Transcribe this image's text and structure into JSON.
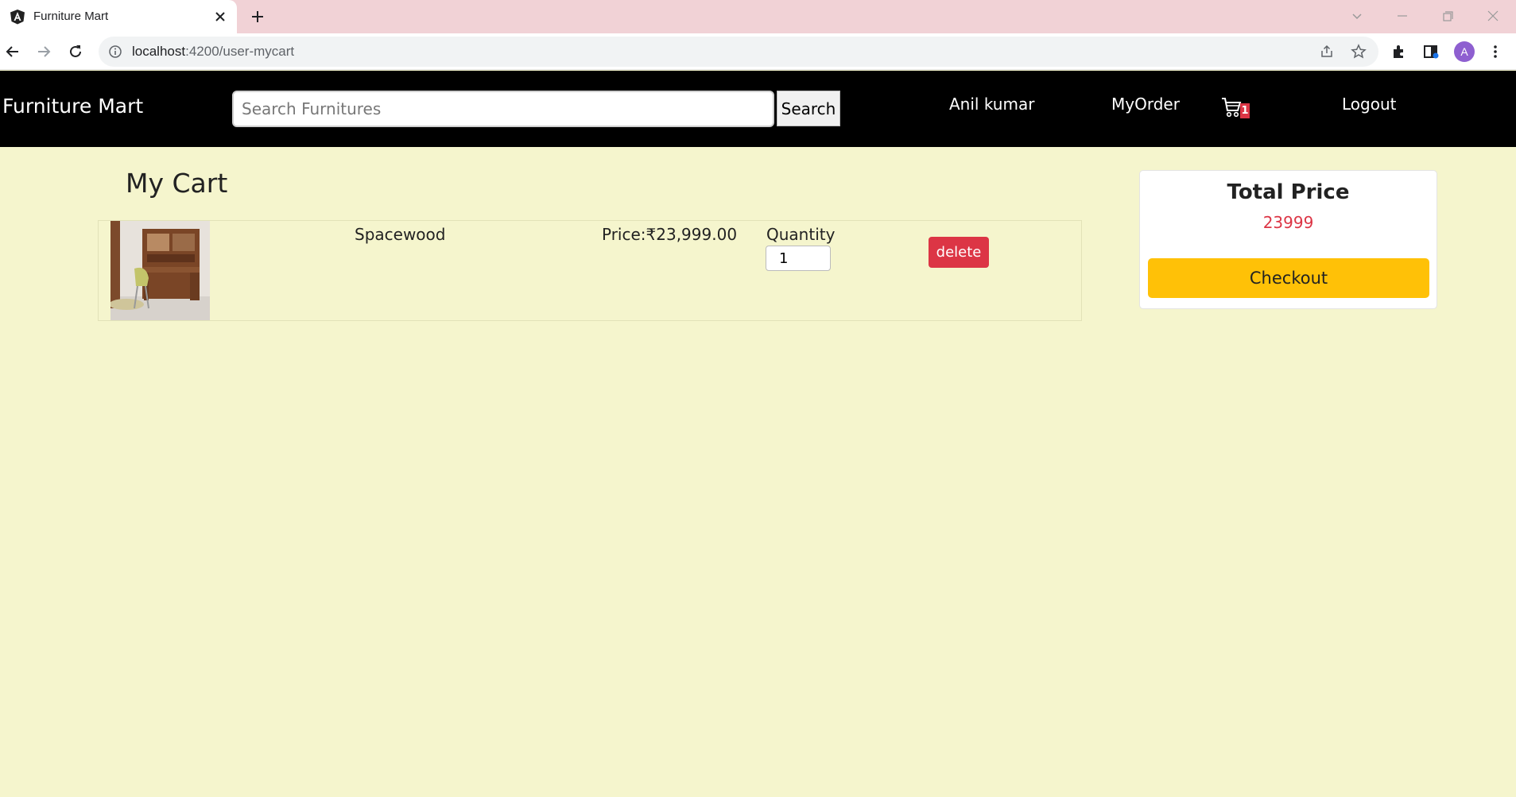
{
  "browser": {
    "tab_title": "Furniture Mart",
    "url_host": "localhost",
    "url_path": ":4200/user-mycart",
    "profile_initial": "A"
  },
  "navbar": {
    "brand": "Furniture Mart",
    "search_placeholder": "Search Furnitures",
    "search_button": "Search",
    "user_name": "Anil kumar",
    "my_order": "MyOrder",
    "cart_count": "1",
    "logout": "Logout"
  },
  "page": {
    "title": "My Cart"
  },
  "cart": {
    "items": [
      {
        "name": "Spacewood",
        "price": "Price:₹23,999.00",
        "quantity_label": "Quantity",
        "quantity": "1",
        "delete_label": "delete"
      }
    ]
  },
  "summary": {
    "title": "Total Price",
    "total": "23999",
    "checkout_label": "Checkout"
  },
  "colors": {
    "page_bg": "#f5f5cd",
    "navbar_bg": "#000000",
    "delete": "#dc3545",
    "checkout": "#ffc107",
    "total_text": "#dc3545"
  }
}
